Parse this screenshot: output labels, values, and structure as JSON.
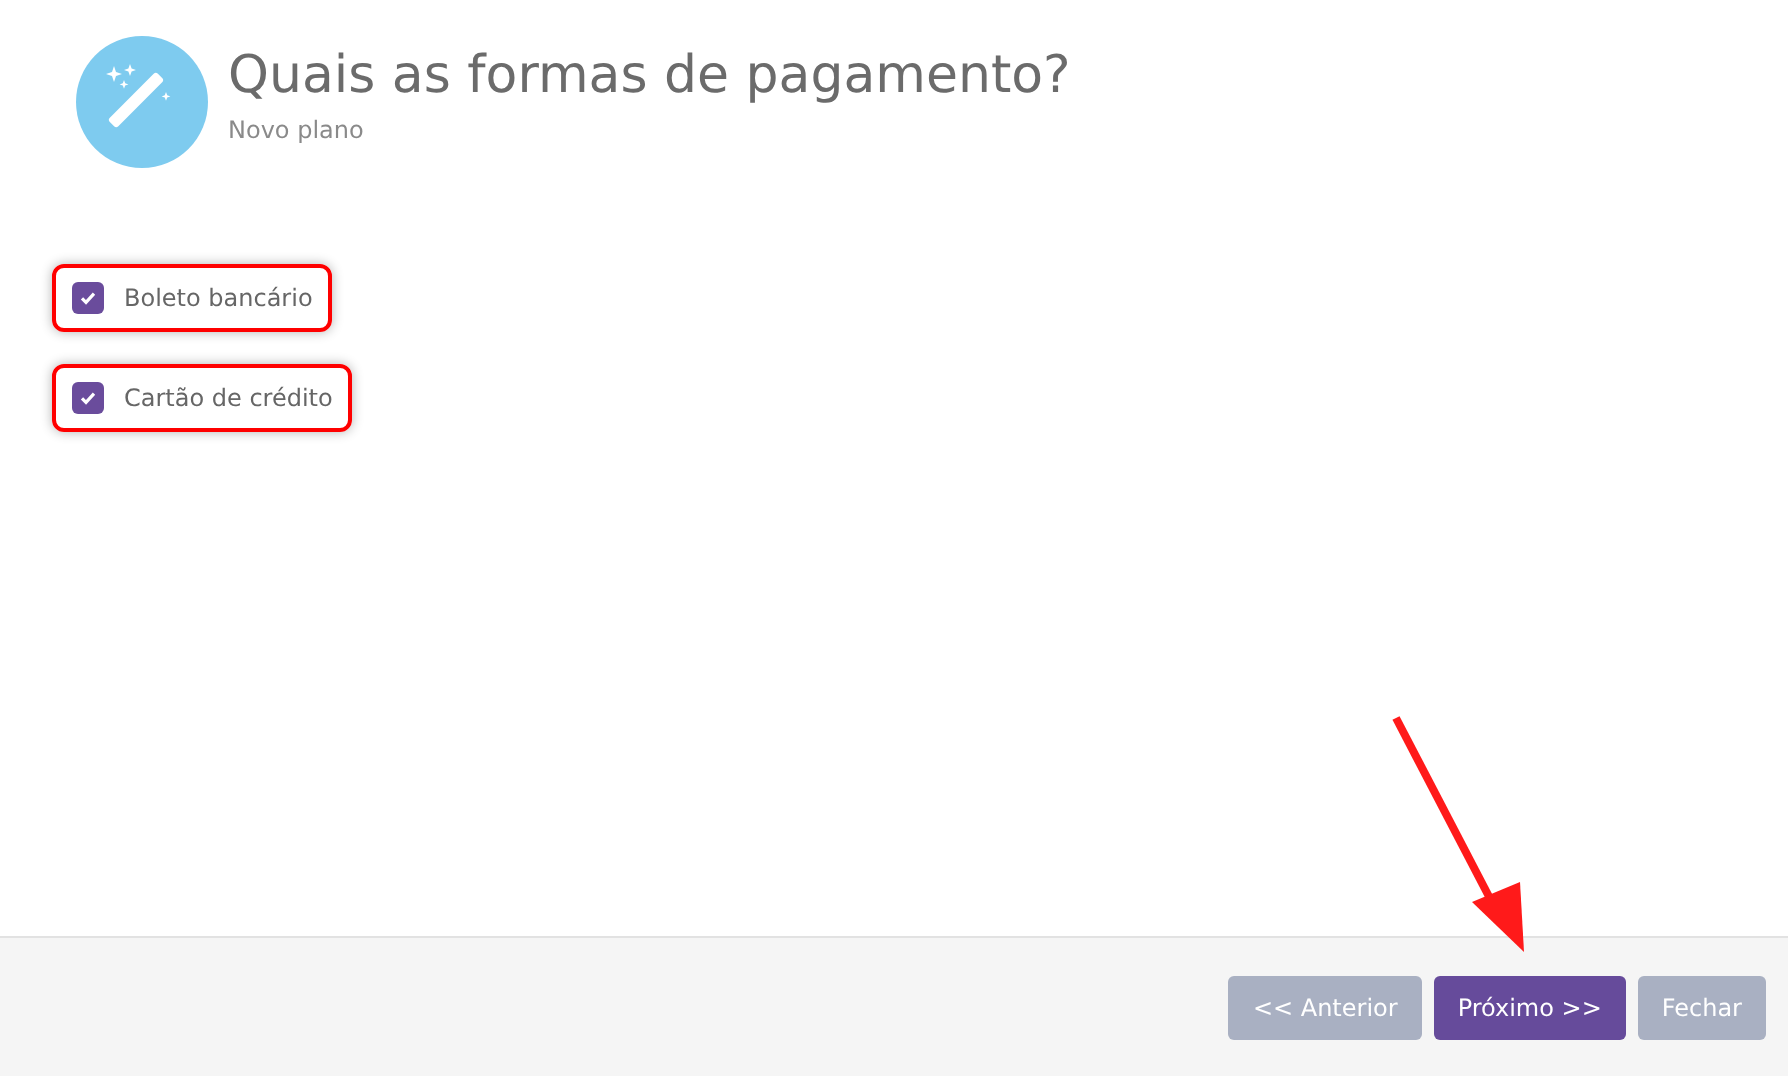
{
  "header": {
    "title": "Quais as formas de pagamento?",
    "subtitle": "Novo plano"
  },
  "options": [
    {
      "label": "Boleto bancário",
      "checked": true,
      "highlighted": true
    },
    {
      "label": "Cartão de crédito",
      "checked": true,
      "highlighted": true
    }
  ],
  "buttons": [
    {
      "label": "<< Anterior",
      "kind": "secondary",
      "disabled": true
    },
    {
      "label": "Próximo >>",
      "kind": "primary",
      "disabled": false
    },
    {
      "label": "Fechar",
      "kind": "secondary",
      "disabled": true
    }
  ]
}
